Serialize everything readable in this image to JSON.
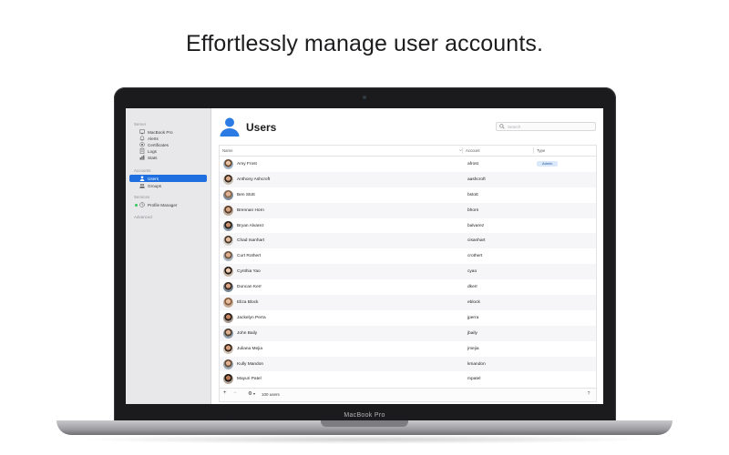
{
  "headline": "Effortlessly manage user accounts.",
  "device_label": "MacBook Pro",
  "sidebar": {
    "sections": [
      {
        "label": "Server"
      },
      {
        "label": "Accounts"
      },
      {
        "label": "Services"
      },
      {
        "label": "Advanced"
      }
    ],
    "items": [
      {
        "label": "MacBook Pro",
        "icon": "display-icon"
      },
      {
        "label": "Alerts",
        "icon": "bell-icon"
      },
      {
        "label": "Certificates",
        "icon": "certificate-icon"
      },
      {
        "label": "Logs",
        "icon": "document-icon"
      },
      {
        "label": "Stats",
        "icon": "stats-icon"
      },
      {
        "label": "Users",
        "icon": "user-icon",
        "selected": true
      },
      {
        "label": "Groups",
        "icon": "group-icon"
      },
      {
        "label": "Profile Manager",
        "icon": "profile-manager-icon",
        "status": "running"
      }
    ]
  },
  "main": {
    "title": "Users",
    "search": {
      "placeholder": "Search",
      "value": ""
    },
    "columns": [
      "Name",
      "Account",
      "Type"
    ],
    "rows": [
      {
        "name": "Amy Frost",
        "account": "afrost",
        "type": "Admin"
      },
      {
        "name": "Anthony Ashcroft",
        "account": "aashcroft",
        "type": ""
      },
      {
        "name": "Ben Stott",
        "account": "bstott",
        "type": ""
      },
      {
        "name": "Brennan Horn",
        "account": "bhorn",
        "type": ""
      },
      {
        "name": "Bryan Alvarez",
        "account": "balvarez",
        "type": ""
      },
      {
        "name": "Chad Isanhart",
        "account": "cisanhart",
        "type": ""
      },
      {
        "name": "Curt Rothert",
        "account": "crothert",
        "type": ""
      },
      {
        "name": "Cynthia Yao",
        "account": "cyao",
        "type": ""
      },
      {
        "name": "Duncan Kerr",
        "account": "dkerr",
        "type": ""
      },
      {
        "name": "Eliza Block",
        "account": "eblock",
        "type": ""
      },
      {
        "name": "Jackelyn Perra",
        "account": "jperra",
        "type": ""
      },
      {
        "name": "John Baily",
        "account": "jbaily",
        "type": ""
      },
      {
        "name": "Juliana Mejia",
        "account": "jmejia",
        "type": ""
      },
      {
        "name": "Kully Mandon",
        "account": "kmandon",
        "type": ""
      },
      {
        "name": "Mayuri Patel",
        "account": "mpatel",
        "type": ""
      }
    ],
    "footer": {
      "add": "+",
      "remove": "−",
      "gear": "⚙",
      "chevron": "▾",
      "count": "100 users",
      "help": "?"
    }
  },
  "colors": {
    "accent": "#1f6fe0",
    "status_green": "#35c759",
    "badge_bg": "#d9e8fb"
  }
}
